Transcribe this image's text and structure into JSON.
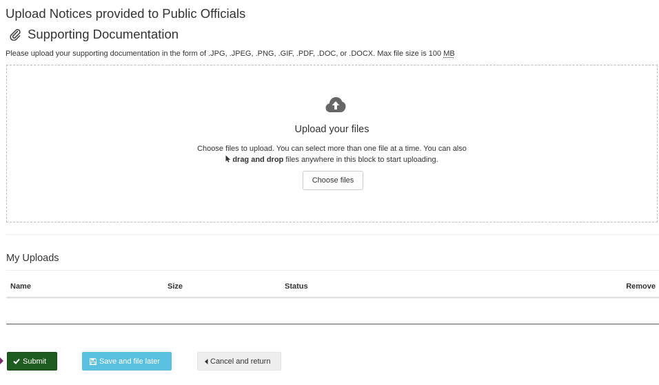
{
  "header": {
    "title": "Upload Notices provided to Public Officials",
    "section_title": "Supporting Documentation",
    "instructions_prefix": "Please upload your supporting documentation in the form of .JPG, .JPEG, .PNG, .GIF, .PDF, .DOC, or .DOCX. Max file size is 100 ",
    "instructions_unit": "MB"
  },
  "dropzone": {
    "title": "Upload your files",
    "line1": "Choose files to upload. You can select more than one file at a time. You can also",
    "line2_bold": "drag and drop",
    "line2_rest": " files anywhere in this block to start uploading.",
    "choose_button": "Choose files",
    "icons": {
      "upload": "cloud-upload-icon",
      "pointer": "mouse-pointer-icon"
    }
  },
  "uploads": {
    "title": "My Uploads",
    "columns": [
      "Name",
      "Size",
      "Status",
      "Remove"
    ],
    "rows": []
  },
  "actions": {
    "submit": "Submit",
    "save": "Save and file later",
    "cancel": "Cancel and return"
  },
  "colors": {
    "submit_bg": "#1f5c1f",
    "save_bg": "#5bc0de",
    "cancel_bg": "#eeeeee",
    "icon_gray": "#666666",
    "focus_marker": "#7a2a6a"
  }
}
